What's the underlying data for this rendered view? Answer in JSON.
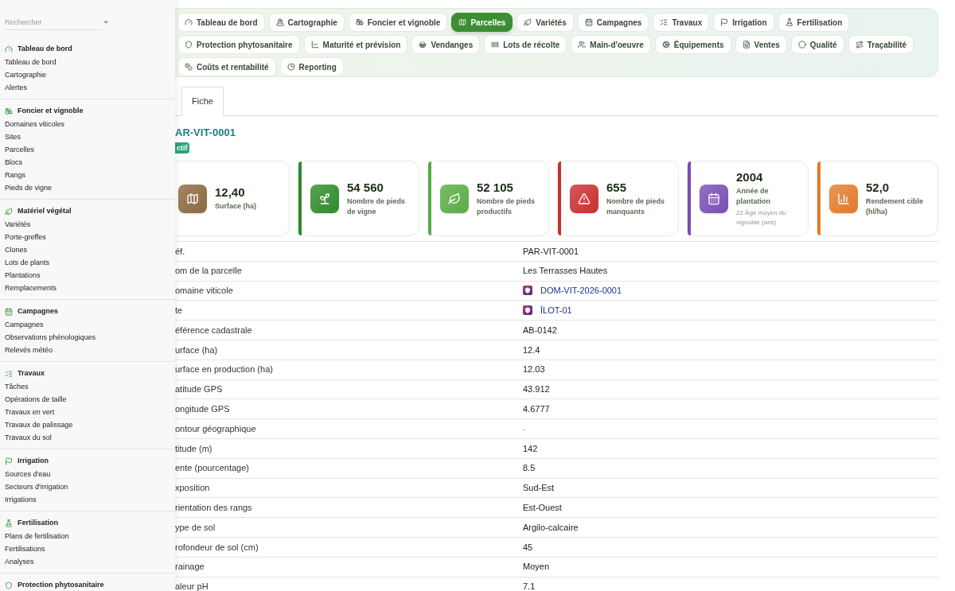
{
  "sidebar": {
    "search": {
      "placeholder": "Rechercher"
    },
    "groups": [
      {
        "title": "Tableau de bord",
        "items": [
          "Tableau de bord",
          "Cartographie",
          "Alertes"
        ]
      },
      {
        "title": "Foncier et vignoble",
        "items": [
          "Domaines viticoles",
          "Sites",
          "Parcelles",
          "Blocs",
          "Rangs",
          "Pieds de vigne"
        ]
      },
      {
        "title": "Matériel végétal",
        "items": [
          "Variétés",
          "Porte-greffes",
          "Clones",
          "Lots de plants",
          "Plantations",
          "Remplacements"
        ]
      },
      {
        "title": "Campagnes",
        "items": [
          "Campagnes",
          "Observations phénologiques",
          "Relevés météo"
        ]
      },
      {
        "title": "Travaux",
        "items": [
          "Tâches",
          "Opérations de taille",
          "Travaux en vert",
          "Travaux de palissage",
          "Travaux du sol"
        ]
      },
      {
        "title": "Irrigation",
        "items": [
          "Sources d'eau",
          "Secteurs d'irrigation",
          "Irrigations"
        ]
      },
      {
        "title": "Fertilisation",
        "items": [
          "Plans de fertilisation",
          "Fertilisations",
          "Analyses"
        ]
      },
      {
        "title": "Protection phytosanitaire"
      }
    ]
  },
  "nav": [
    {
      "label": "Tableau de bord",
      "selected": false
    },
    {
      "label": "Cartographie",
      "selected": false
    },
    {
      "label": "Foncier et vignoble",
      "selected": false
    },
    {
      "label": "Parcelles",
      "selected": true
    },
    {
      "label": "Variétés",
      "selected": false
    },
    {
      "label": "Campagnes",
      "selected": false
    },
    {
      "label": "Travaux",
      "selected": false
    },
    {
      "label": "Irrigation",
      "selected": false
    },
    {
      "label": "Fertilisation",
      "selected": false
    },
    {
      "label": "Protection phytosanitaire",
      "selected": false
    },
    {
      "label": "Maturité et prévision",
      "selected": false
    },
    {
      "label": "Vendanges",
      "selected": false
    },
    {
      "label": "Lots de récolte",
      "selected": false
    },
    {
      "label": "Main-d'oeuvre",
      "selected": false
    },
    {
      "label": "Équipements",
      "selected": false
    },
    {
      "label": "Ventes",
      "selected": false
    },
    {
      "label": "Qualité",
      "selected": false
    },
    {
      "label": "Traçabilité",
      "selected": false
    },
    {
      "label": "Coûts et rentabilité",
      "selected": false
    },
    {
      "label": "Reporting",
      "selected": false
    }
  ],
  "tabs": [
    {
      "label": "Fiche",
      "selected": true
    }
  ],
  "record": {
    "title": "AR-VIT-0001",
    "status": "ctif"
  },
  "cards": [
    {
      "value": "12,40",
      "label": "Surface (ha)",
      "color": "#8b6840"
    },
    {
      "value": "54 560",
      "label": "Nombre de pieds de vigne",
      "color": "#2f8a2c"
    },
    {
      "value": "52 105",
      "label": "Nombre de pieds productifs",
      "color": "#5aab45"
    },
    {
      "value": "655",
      "label": "Nombre de pieds manquants",
      "color": "#c92f2f"
    },
    {
      "value": "2004",
      "label": "Année de plantation",
      "sub": "22 Âge moyen du vignoble (ans)",
      "color": "#7a4cb3"
    },
    {
      "value": "52,0",
      "label": "Rendement cible (hl/ha)",
      "color": "#e27b2b"
    }
  ],
  "fields": [
    {
      "label": "éf.",
      "value": "PAR-VIT-0001",
      "kind": "text"
    },
    {
      "label": "om de la parcelle",
      "value": "Les Terrasses Hautes",
      "kind": "text"
    },
    {
      "label": "omaine viticole",
      "value": "DOM-VIT-2026-0001",
      "kind": "link"
    },
    {
      "label": "te",
      "value": "ÎLOT-01",
      "kind": "link"
    },
    {
      "label": "éférence cadastrale",
      "value": "AB-0142",
      "kind": "text"
    },
    {
      "label": "urface (ha)",
      "value": "12.4",
      "kind": "text"
    },
    {
      "label": "urface en production (ha)",
      "value": "12.03",
      "kind": "text"
    },
    {
      "label": "atitude GPS",
      "value": "43.912",
      "kind": "text"
    },
    {
      "label": "ongitude GPS",
      "value": "4.6777",
      "kind": "text"
    },
    {
      "label": "ontour géographique",
      "value": "-",
      "kind": "empty"
    },
    {
      "label": "titude (m)",
      "value": "142",
      "kind": "text"
    },
    {
      "label": "ente (pourcentage)",
      "value": "8.5",
      "kind": "text"
    },
    {
      "label": "xposition",
      "value": "Sud-Est",
      "kind": "text"
    },
    {
      "label": "rientation des rangs",
      "value": "Est-Ouest",
      "kind": "text"
    },
    {
      "label": "ype de sol",
      "value": "Argilo-calcaire",
      "kind": "text"
    },
    {
      "label": "rofondeur de sol (cm)",
      "value": "45",
      "kind": "text"
    },
    {
      "label": "rainage",
      "value": "Moyen",
      "kind": "text"
    },
    {
      "label": "aleur pH",
      "value": "7.1",
      "kind": "text"
    }
  ]
}
